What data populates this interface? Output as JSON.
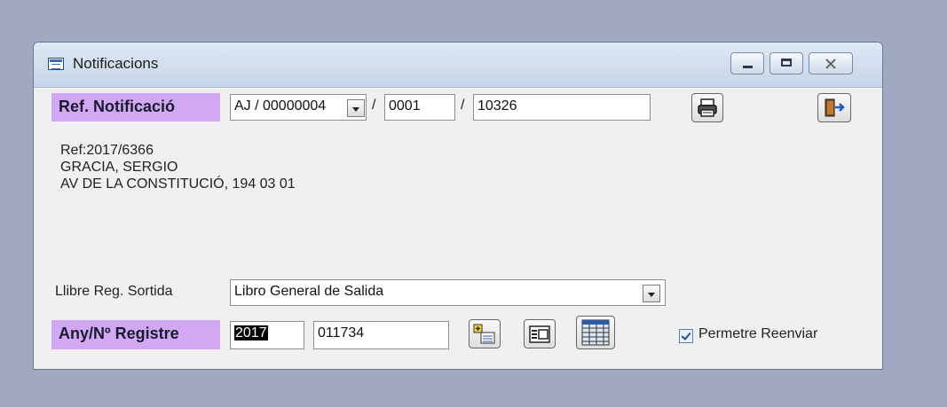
{
  "window": {
    "title": "Notificacions"
  },
  "ref": {
    "label": "Ref. Notificació",
    "code": "AJ / 00000004",
    "sep1": "/",
    "part2": "0001",
    "sep2": "/",
    "part3": "10326"
  },
  "info": {
    "line1": "Ref:2017/6366",
    "line2": "GRACIA, SERGIO",
    "line3": "AV DE LA CONSTITUCIÓ,  194 03 01"
  },
  "llibre": {
    "label": "Llibre Reg. Sortida",
    "value": "Libro General de Salida"
  },
  "registre": {
    "label": "Any/Nº Registre",
    "year": "2017",
    "number": "011734"
  },
  "permetre": {
    "label": "Permetre Reenviar",
    "checked": true
  },
  "icons": {
    "print": "printer-icon",
    "exit": "exit-door-icon",
    "new": "add-record-icon",
    "form": "form-icon",
    "grid": "grid-icon"
  }
}
